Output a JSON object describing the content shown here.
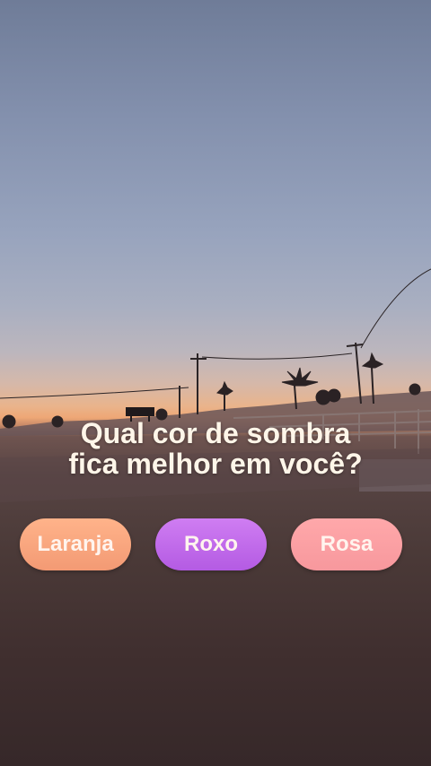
{
  "question": {
    "line1": "Qual cor de sombra",
    "line2": "fica melhor em você?"
  },
  "options": [
    {
      "label": "Laranja",
      "color": "#f7a47e"
    },
    {
      "label": "Roxo",
      "color": "#c16ae9"
    },
    {
      "label": "Rosa",
      "color": "#fb9fa3"
    }
  ],
  "background": {
    "sky_top": "#6f7c98",
    "horizon": "#eea776",
    "ground": "#402f2f"
  }
}
